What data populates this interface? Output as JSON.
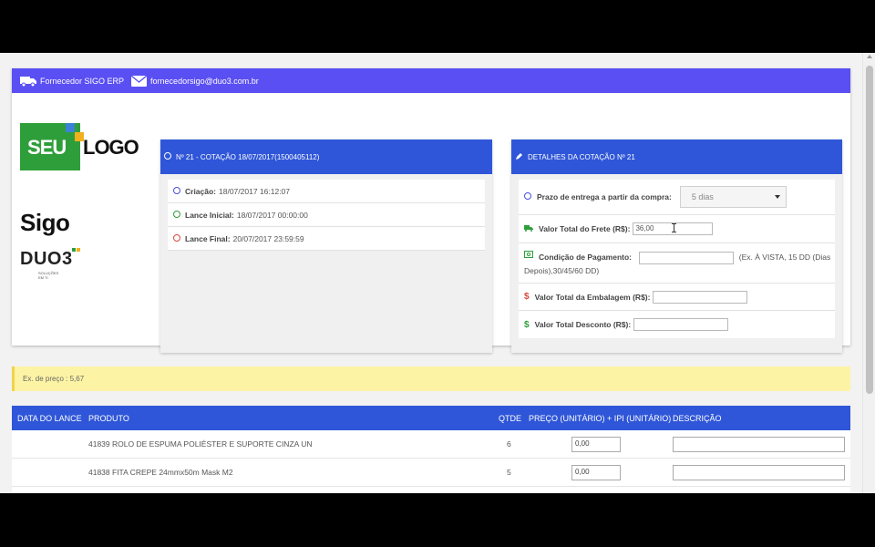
{
  "header": {
    "supplier_name": "Fornecedor SIGO ERP",
    "supplier_email": "fornecedorsigo@duo3.com.br",
    "icons": [
      "truck-icon",
      "envelope-icon"
    ],
    "color": "#5a4ff2"
  },
  "logos": {
    "seu": "SEU",
    "logo": "LOGO",
    "sigo": "Sigo",
    "duo3": "DUO3",
    "duo3_sub": "SOLUÇÕES EM TI"
  },
  "quote": {
    "title": "Nº 21 - COTAÇÃO 18/07/2017(1500405112)",
    "created_label": "Criação:",
    "created_value": "18/07/2017 16:12:07",
    "initial_label": "Lance Inicial:",
    "initial_value": "18/07/2017 00:00:00",
    "final_label": "Lance Final:",
    "final_value": "20/07/2017 23:59:59"
  },
  "details": {
    "title": "DETALHES DA COTAÇÃO Nº 21",
    "delivery_label": "Prazo de entrega a partir da compra:",
    "delivery_value": "5 dias",
    "freight_label": "Valor Total do Frete (R$):",
    "freight_value": "36,00",
    "payment_label": "Condição de Pagamento:",
    "payment_value": "",
    "payment_hint_1": "(Ex. À VISTA, 15 DD (Dias",
    "payment_hint_2": "Depois),30/45/60 DD)",
    "packaging_label": "Valor Total da Embalagem (R$):",
    "packaging_value": "",
    "discount_label": "Valor Total Desconto (R$):",
    "discount_value": ""
  },
  "notice": {
    "text": "Ex. de preço : 5,67"
  },
  "table": {
    "headers": {
      "date": "DATA DO LANCE",
      "product": "PRODUTO",
      "qty": "QTDE",
      "price": "PREÇO (UNITÁRIO) + IPI (UNITÁRIO)",
      "desc": "DESCRIÇÃO"
    },
    "rows": [
      {
        "date": "",
        "product": "41839 ROLO DE ESPUMA POLIÉSTER E SUPORTE CINZA UN",
        "qty": "6",
        "price": "0,00",
        "desc": ""
      },
      {
        "date": "",
        "product": "41838 FITA CREPE 24mmx50m Mask M2",
        "qty": "5",
        "price": "0,00",
        "desc": ""
      }
    ]
  }
}
